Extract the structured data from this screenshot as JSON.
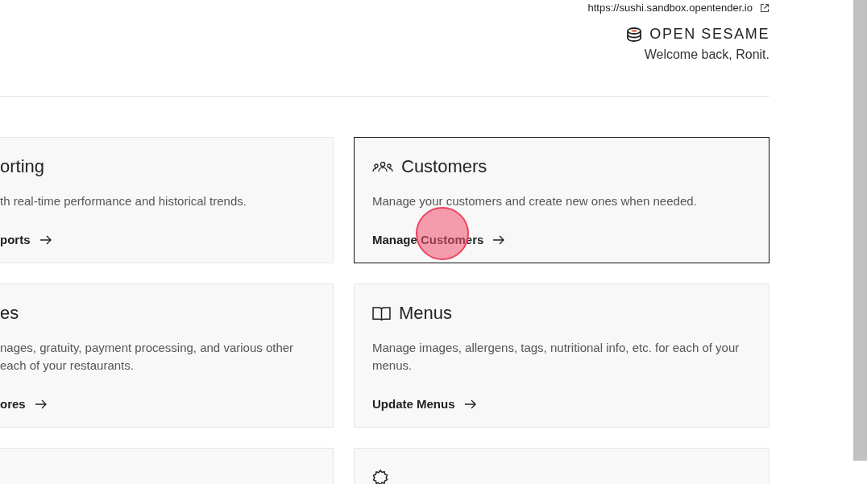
{
  "header": {
    "site_url": "https://sushi.sandbox.opentender.io",
    "brand": "OPEN SESAME",
    "welcome": "Welcome back, Ronit."
  },
  "cards": [
    {
      "title": "orting",
      "description": "th real-time performance and historical trends.",
      "link": "ports",
      "highlighted": false
    },
    {
      "title": "Customers",
      "description": "Manage your customers and create new ones when needed.",
      "link": "Manage Customers",
      "highlighted": true
    },
    {
      "title": "es",
      "description": "nages, gratuity, payment processing, and various other\n each of your restaurants.",
      "link": "ores",
      "highlighted": false
    },
    {
      "title": "Menus",
      "description": "Manage images, allergens, tags, nutritional info, etc. for each of your menus.",
      "link": "Update Menus",
      "highlighted": false
    },
    {
      "highlighted": false
    },
    {
      "highlighted": false
    }
  ]
}
